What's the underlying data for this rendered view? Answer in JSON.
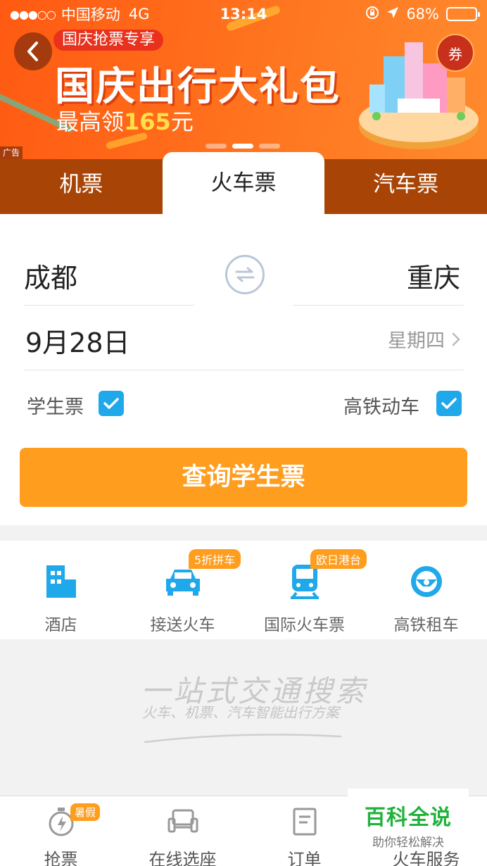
{
  "status_bar": {
    "signal": "●●●○○",
    "carrier": "中国移动",
    "network": "4G",
    "time": "13:14",
    "battery_text": "68%",
    "battery_level": 0.68
  },
  "banner": {
    "tag": "国庆抢票专享",
    "title": "国庆出行大礼包",
    "subtitle_prefix": "最高领",
    "subtitle_amount": "165",
    "subtitle_suffix": "元",
    "coupon": "券",
    "ad_label": "广告",
    "pager_count": 3,
    "pager_active": 1
  },
  "tabs": [
    {
      "label": "机票",
      "active": false
    },
    {
      "label": "火车票",
      "active": true
    },
    {
      "label": "汽车票",
      "active": false
    }
  ],
  "search": {
    "from_city": "成都",
    "to_city": "重庆",
    "date": "9月28日",
    "weekday": "星期四",
    "option_student": "学生票",
    "option_student_checked": true,
    "option_highspeed": "高铁动车",
    "option_highspeed_checked": true,
    "submit": "查询学生票"
  },
  "services": [
    {
      "label": "酒店",
      "icon": "hotel-icon",
      "badge": ""
    },
    {
      "label": "接送火车",
      "icon": "car-icon",
      "badge": "5折拼车"
    },
    {
      "label": "国际火车票",
      "icon": "train-icon",
      "badge": "欧日港台"
    },
    {
      "label": "高铁租车",
      "icon": "steering-wheel-icon",
      "badge": ""
    }
  ],
  "slogan": {
    "title": "一站式交通搜索",
    "subtitle": "火车、机票、汽车智能出行方案"
  },
  "bottom_nav": [
    {
      "label": "抢票",
      "icon": "stopwatch-icon",
      "badge": "暑假"
    },
    {
      "label": "在线选座",
      "icon": "seat-icon",
      "badge": ""
    },
    {
      "label": "订单",
      "icon": "order-icon",
      "badge": ""
    },
    {
      "label": "火车服务",
      "icon": "service-icon",
      "badge": ""
    }
  ],
  "watermark": {
    "title": "百科全说",
    "subtitle": "助你轻松解决"
  },
  "colors": {
    "banner_orange": "#ff6a1a",
    "tab_bar": "#a84506",
    "primary_button": "#ff9d1e",
    "checkbox": "#1fa8ea",
    "service_icon": "#1fa8ea"
  }
}
